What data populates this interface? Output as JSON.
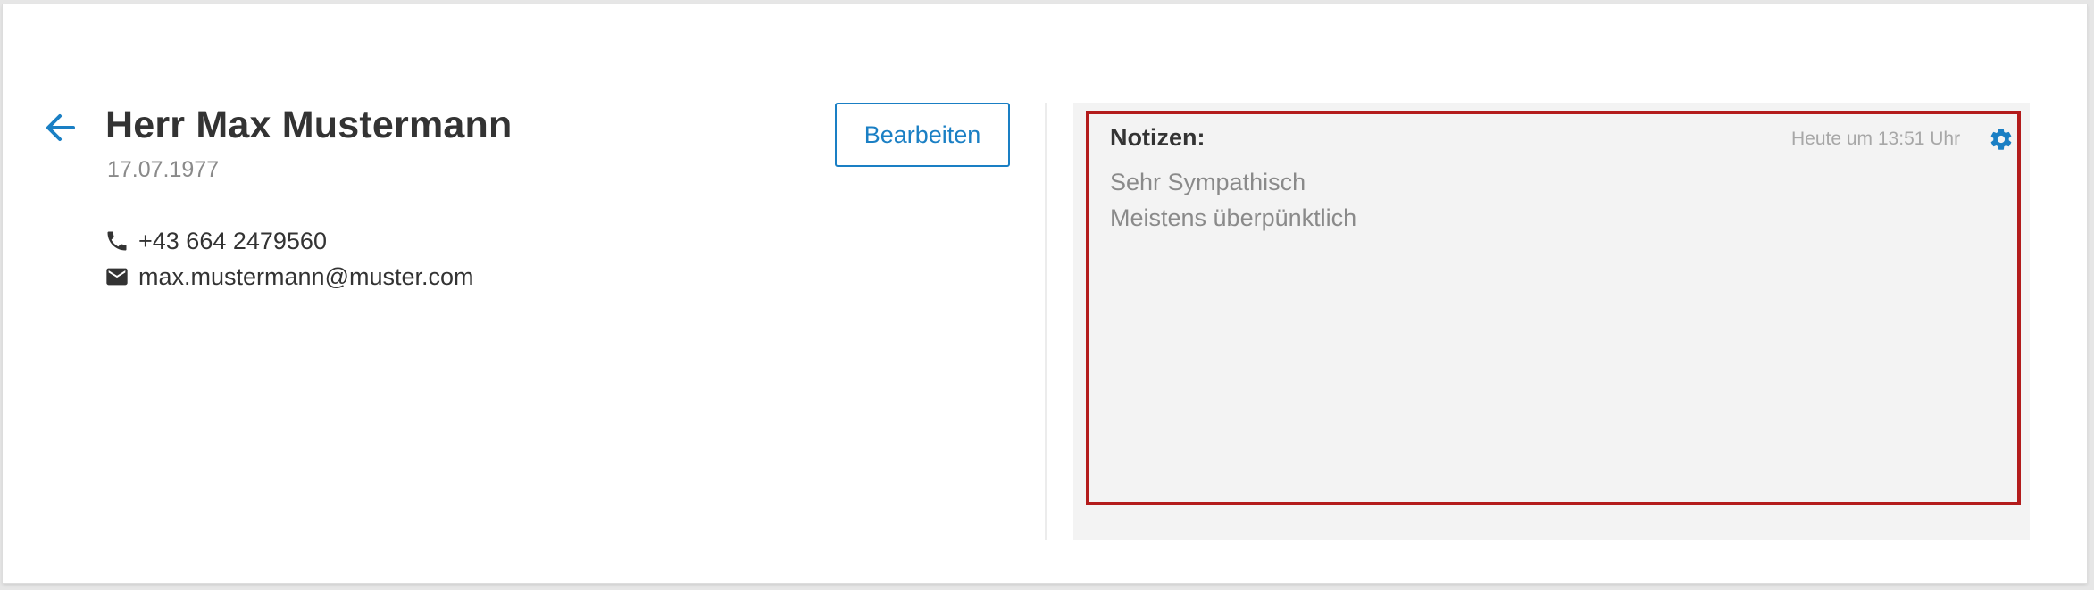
{
  "contact": {
    "name": "Herr Max Mustermann",
    "birthdate": "17.07.1977",
    "phone": "+43 664 2479560",
    "email": "max.mustermann@muster.com"
  },
  "actions": {
    "back_icon": "arrow-left-icon",
    "edit_label": "Bearbeiten"
  },
  "notes": {
    "heading": "Notizen:",
    "timestamp": "Heute um 13:51 Uhr",
    "settings_icon": "gear-icon",
    "lines": [
      "Sehr Sympathisch",
      "Meistens überpünktlich"
    ]
  },
  "colors": {
    "accent": "#1a7fc4",
    "highlight_border": "#b31b1b",
    "notes_background": "#f3f3f3"
  }
}
